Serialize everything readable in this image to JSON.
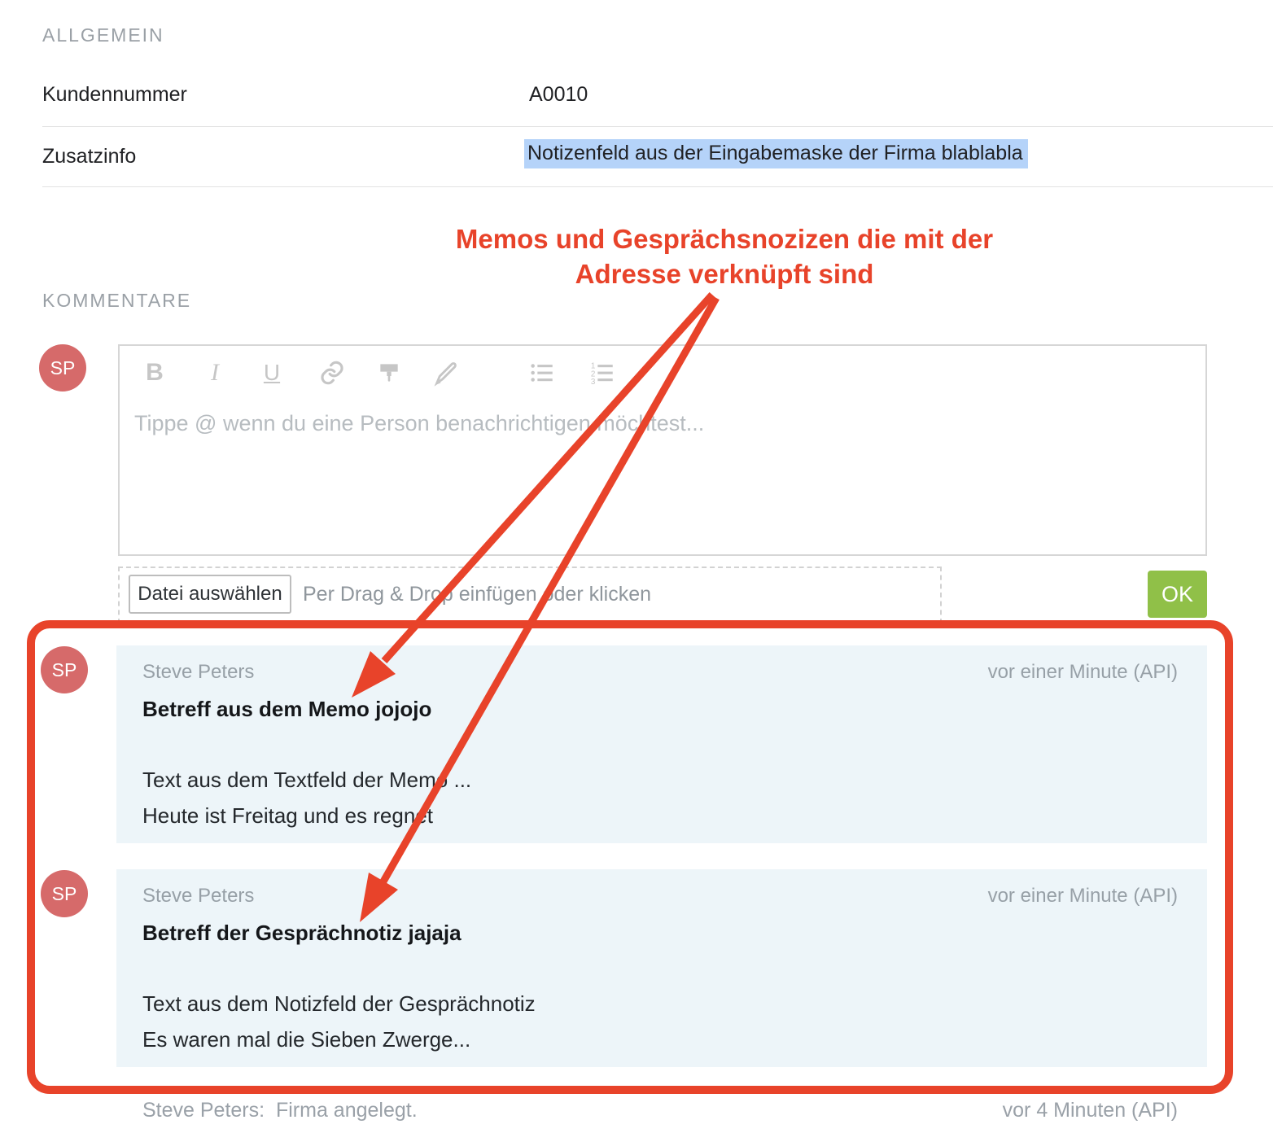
{
  "general": {
    "section_title": "ALLGEMEIN",
    "rows": [
      {
        "label": "Kundennummer",
        "value": "A0010"
      },
      {
        "label": "Zusatzinfo",
        "value": "Notizenfeld aus der Eingabemaske der Firma blablabla"
      }
    ]
  },
  "annotation": {
    "line1": "Memos und Gesprächsnozizen die mit der",
    "line2": "Adresse verknüpft sind"
  },
  "comments_section": {
    "section_title": "KOMMENTARE",
    "editor": {
      "avatar_initials": "SP",
      "toolbar": {
        "bold_label": "B",
        "italic_label": "I",
        "underline_label": "U"
      },
      "placeholder": "Tippe @ wenn du eine Person benachrichtigen möchtest...",
      "upload_button_label": "Datei auswählen",
      "upload_hint": "Per Drag & Drop einfügen oder klicken",
      "submit_label": "OK"
    },
    "comments": [
      {
        "avatar_initials": "SP",
        "author": "Steve Peters",
        "timestamp": "vor einer Minute (API)",
        "title": "Betreff aus dem Memo jojojo",
        "body_line1": "Text aus dem Textfeld der Memo ...",
        "body_line2": "Heute ist Freitag und es regnet"
      },
      {
        "avatar_initials": "SP",
        "author": "Steve Peters",
        "timestamp": "vor einer Minute (API)",
        "title": "Betreff der Gesprächnotiz jajaja",
        "body_line1": "Text aus dem Notizfeld der Gesprächnotiz",
        "body_line2": "Es waren mal die Sieben Zwerge..."
      }
    ],
    "activity": {
      "author": "Steve Peters:",
      "action": "Firma angelegt.",
      "timestamp": "vor 4 Minuten (API)"
    }
  },
  "colors": {
    "annotation_red": "#e8432a",
    "avatar_background": "#d66a6a",
    "comment_background": "#edf5f9",
    "ok_green": "#90c048",
    "selection_highlight": "#b5d3f9"
  }
}
